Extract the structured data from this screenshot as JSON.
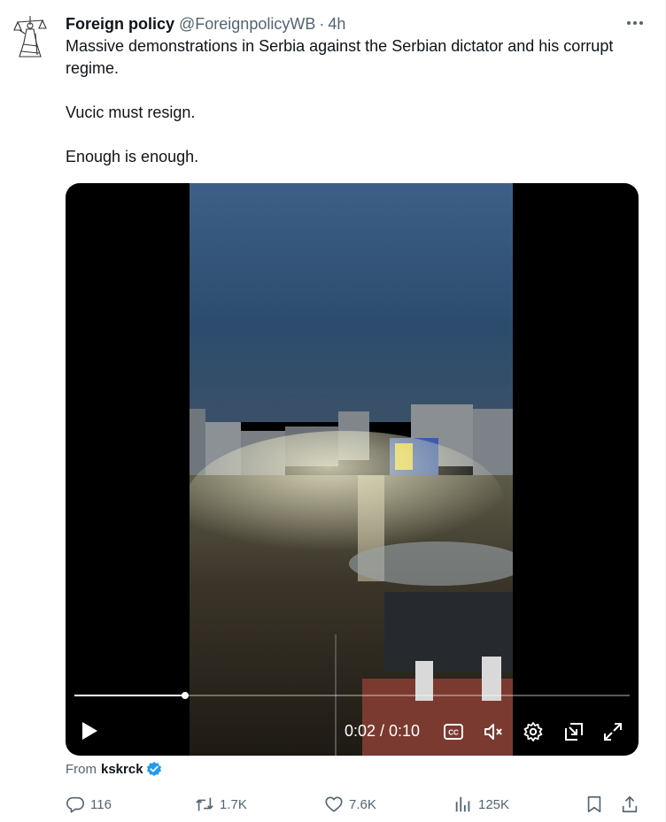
{
  "author": {
    "display_name": "Foreign policy",
    "handle": "@ForeignpolicyWB",
    "separator": "·",
    "time": "4h",
    "avatar_icon": "lady-justice-avatar"
  },
  "tweet": {
    "paragraphs": [
      "Massive demonstrations in Serbia against the Serbian dictator and his corrupt regime.",
      "Vucic must resign.",
      "Enough is enough."
    ]
  },
  "video": {
    "current_time": "0:02",
    "duration": "0:10",
    "time_display": "0:02 / 0:10",
    "progress_fraction": 0.2,
    "controls": [
      "play-icon",
      "captions-icon",
      "mute-icon",
      "settings-icon",
      "pop-out-icon",
      "fullscreen-icon"
    ]
  },
  "attribution": {
    "prefix": "From",
    "user": "kskrck",
    "verified": true
  },
  "actions": {
    "replies": "116",
    "reposts": "1.7K",
    "likes": "7.6K",
    "views": "125K"
  },
  "colors": {
    "text_primary": "#0f1419",
    "text_secondary": "#536471",
    "verified_blue": "#1d9bf0",
    "media_background": "#000000"
  }
}
